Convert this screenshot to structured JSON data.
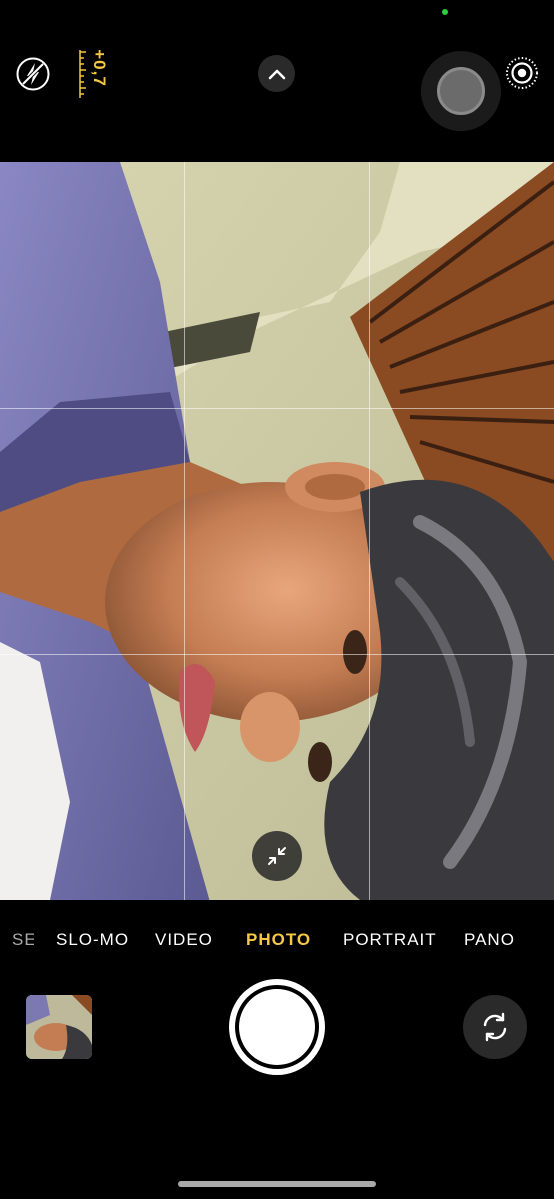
{
  "top_bar": {
    "flash_icon": "flash-off-icon",
    "exposure_value": "+0,7",
    "controls_toggle_icon": "chevron-up-icon",
    "live_photo_icon": "live-photo-icon"
  },
  "viewfinder": {
    "zoom_icon": "collapse-arrows-icon"
  },
  "modes": [
    {
      "label": "SE",
      "active": false
    },
    {
      "label": "SLO-MO",
      "active": false
    },
    {
      "label": "VIDEO",
      "active": false
    },
    {
      "label": "PHOTO",
      "active": true
    },
    {
      "label": "PORTRAIT",
      "active": false
    },
    {
      "label": "PANO",
      "active": false
    }
  ],
  "bottom_bar": {
    "thumbnail_icon": "last-photo-thumbnail",
    "shutter_icon": "shutter-icon",
    "flip_icon": "camera-flip-icon"
  },
  "colors": {
    "accent": "#f6c945",
    "background": "#000000",
    "privacy_indicator": "#2ecc40"
  }
}
